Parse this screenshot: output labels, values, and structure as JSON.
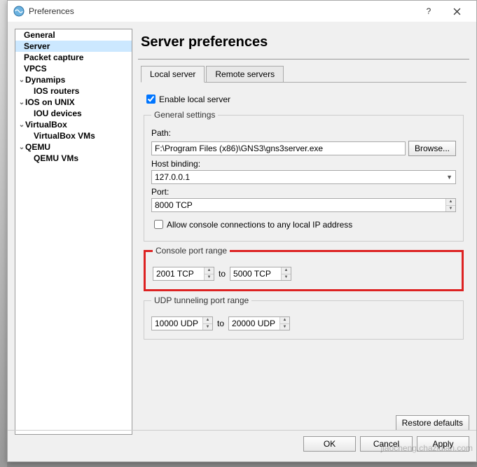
{
  "window": {
    "title": "Preferences"
  },
  "sidebar": {
    "items": [
      {
        "label": "General",
        "bold": true,
        "selected": false,
        "indent": 8,
        "arrow": ""
      },
      {
        "label": "Server",
        "bold": true,
        "selected": true,
        "indent": 8,
        "arrow": ""
      },
      {
        "label": "Packet capture",
        "bold": true,
        "selected": false,
        "indent": 8,
        "arrow": ""
      },
      {
        "label": "VPCS",
        "bold": true,
        "selected": false,
        "indent": 8,
        "arrow": ""
      },
      {
        "label": "Dynamips",
        "bold": true,
        "selected": false,
        "indent": 0,
        "arrow": "⌄"
      },
      {
        "label": "IOS routers",
        "bold": true,
        "selected": false,
        "indent": 22,
        "arrow": ""
      },
      {
        "label": "IOS on UNIX",
        "bold": true,
        "selected": false,
        "indent": 0,
        "arrow": "⌄"
      },
      {
        "label": "IOU devices",
        "bold": true,
        "selected": false,
        "indent": 22,
        "arrow": ""
      },
      {
        "label": "VirtualBox",
        "bold": true,
        "selected": false,
        "indent": 0,
        "arrow": "⌄"
      },
      {
        "label": "VirtualBox VMs",
        "bold": true,
        "selected": false,
        "indent": 22,
        "arrow": ""
      },
      {
        "label": "QEMU",
        "bold": true,
        "selected": false,
        "indent": 0,
        "arrow": "⌄"
      },
      {
        "label": "QEMU VMs",
        "bold": true,
        "selected": false,
        "indent": 22,
        "arrow": ""
      }
    ]
  },
  "page": {
    "title": "Server preferences"
  },
  "tabs": {
    "local": "Local server",
    "remote": "Remote servers"
  },
  "local": {
    "enable_label": "Enable local server",
    "enable_checked": true,
    "general_legend": "General settings",
    "path_label": "Path:",
    "path_value": "F:\\Program Files (x86)\\GNS3\\gns3server.exe",
    "browse_label": "Browse...",
    "host_label": "Host binding:",
    "host_value": "127.0.0.1",
    "port_label": "Port:",
    "port_value": "8000 TCP",
    "allow_any_label": "Allow console connections to any local IP address",
    "allow_any_checked": false,
    "console_legend": "Console port range",
    "console_from": "2001 TCP",
    "console_to": "5000 TCP",
    "to_label": "to",
    "udp_legend": "UDP tunneling port range",
    "udp_from": "10000 UDP",
    "udp_to": "20000 UDP"
  },
  "buttons": {
    "restore": "Restore defaults",
    "ok": "OK",
    "cancel": "Cancel",
    "apply": "Apply"
  },
  "watermark": "jiaocheng.chazidian.com"
}
